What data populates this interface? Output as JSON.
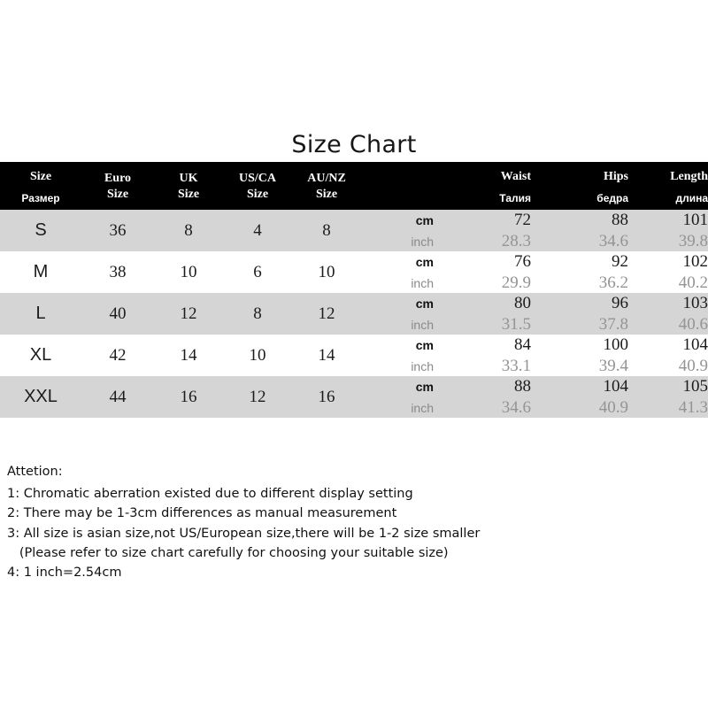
{
  "title": "Size Chart",
  "table": {
    "headers": {
      "size": {
        "main": "Size",
        "sub": "Размер"
      },
      "euro": {
        "line1": "Euro",
        "line2": "Size"
      },
      "uk": {
        "line1": "UK",
        "line2": "Size"
      },
      "usca": {
        "line1": "US/CA",
        "line2": "Size"
      },
      "aunz": {
        "line1": "AU/NZ",
        "line2": "Size"
      },
      "unit": "",
      "waist": {
        "main": "Waist",
        "sub": "Талия"
      },
      "hips": {
        "main": "Hips",
        "sub": "бедра"
      },
      "length": {
        "main": "Length",
        "sub": "длина"
      }
    },
    "units": {
      "cm": "cm",
      "inch": "inch"
    },
    "rows": [
      {
        "size": "S",
        "euro": "36",
        "uk": "8",
        "usca": "4",
        "aunz": "8",
        "cm": {
          "waist": "72",
          "hips": "88",
          "length": "101"
        },
        "inch": {
          "waist": "28.3",
          "hips": "34.6",
          "length": "39.8"
        }
      },
      {
        "size": "M",
        "euro": "38",
        "uk": "10",
        "usca": "6",
        "aunz": "10",
        "cm": {
          "waist": "76",
          "hips": "92",
          "length": "102"
        },
        "inch": {
          "waist": "29.9",
          "hips": "36.2",
          "length": "40.2"
        }
      },
      {
        "size": "L",
        "euro": "40",
        "uk": "12",
        "usca": "8",
        "aunz": "12",
        "cm": {
          "waist": "80",
          "hips": "96",
          "length": "103"
        },
        "inch": {
          "waist": "31.5",
          "hips": "37.8",
          "length": "40.6"
        }
      },
      {
        "size": "XL",
        "euro": "42",
        "uk": "14",
        "usca": "10",
        "aunz": "14",
        "cm": {
          "waist": "84",
          "hips": "100",
          "length": "104"
        },
        "inch": {
          "waist": "33.1",
          "hips": "39.4",
          "length": "40.9"
        }
      },
      {
        "size": "XXL",
        "euro": "44",
        "uk": "16",
        "usca": "12",
        "aunz": "16",
        "cm": {
          "waist": "88",
          "hips": "104",
          "length": "105"
        },
        "inch": {
          "waist": "34.6",
          "hips": "40.9",
          "length": "41.3"
        }
      }
    ]
  },
  "notes": {
    "heading": "Attetion:",
    "lines": [
      "1: Chromatic aberration existed due to different display setting",
      "2: There may be 1-3cm differences as manual measurement",
      "3: All size is asian size,not US/European size,there will be 1-2 size smaller",
      "   (Please refer to size chart carefully for choosing your suitable size)",
      "4: 1 inch=2.54cm"
    ]
  },
  "colors": {
    "header_bg": "#000000",
    "header_text": "#ffffff",
    "row_gray": "#d5d5d5",
    "row_white": "#ffffff",
    "text_dark": "#1b1b1b",
    "text_muted": "#949494"
  }
}
